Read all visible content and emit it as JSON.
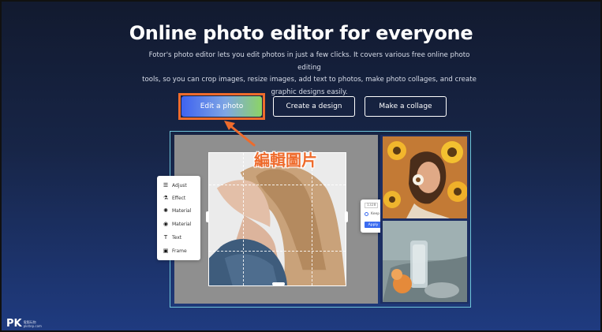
{
  "hero": {
    "title": "Online photo editor for everyone",
    "subtitle_lines": [
      "Fotor's photo editor lets you edit photos in just a few clicks. It covers various free online photo editing",
      "tools, so you can crop images, resize images, add text to photos, make photo collages, and create",
      "graphic designs easily."
    ]
  },
  "buttons": {
    "edit_photo": "Edit a photo",
    "create_design": "Create a design",
    "make_collage": "Make a collage"
  },
  "annotation": {
    "label": "編輯圖片",
    "color": "#ee6b2c"
  },
  "tool_panel": {
    "items": [
      {
        "icon": "sliders-icon",
        "glyph": "☰",
        "label": "Adjust"
      },
      {
        "icon": "flask-icon",
        "glyph": "⚗",
        "label": "Effect"
      },
      {
        "icon": "sparkle-icon",
        "glyph": "✺",
        "label": "Material"
      },
      {
        "icon": "circle-icon",
        "glyph": "◉",
        "label": "Material"
      },
      {
        "icon": "text-icon",
        "glyph": "T",
        "label": "Text"
      },
      {
        "icon": "frame-icon",
        "glyph": "▣",
        "label": "Frame"
      }
    ]
  },
  "crop_popup": {
    "width_value": "1328",
    "height_value": "1366",
    "option": "Keep Aspect Ratio",
    "apply": "Apply",
    "cancel": "Cancel"
  },
  "logo": {
    "text": "PK",
    "sub_lines": [
      "電腦玩物",
      "pkstep.com"
    ]
  },
  "colors": {
    "background_top": "#121a2f",
    "background_bottom": "#1f3b80",
    "accent_blue": "#3b6cf0",
    "accent_green": "#8cd465",
    "highlight_orange": "#ee6b2c"
  }
}
